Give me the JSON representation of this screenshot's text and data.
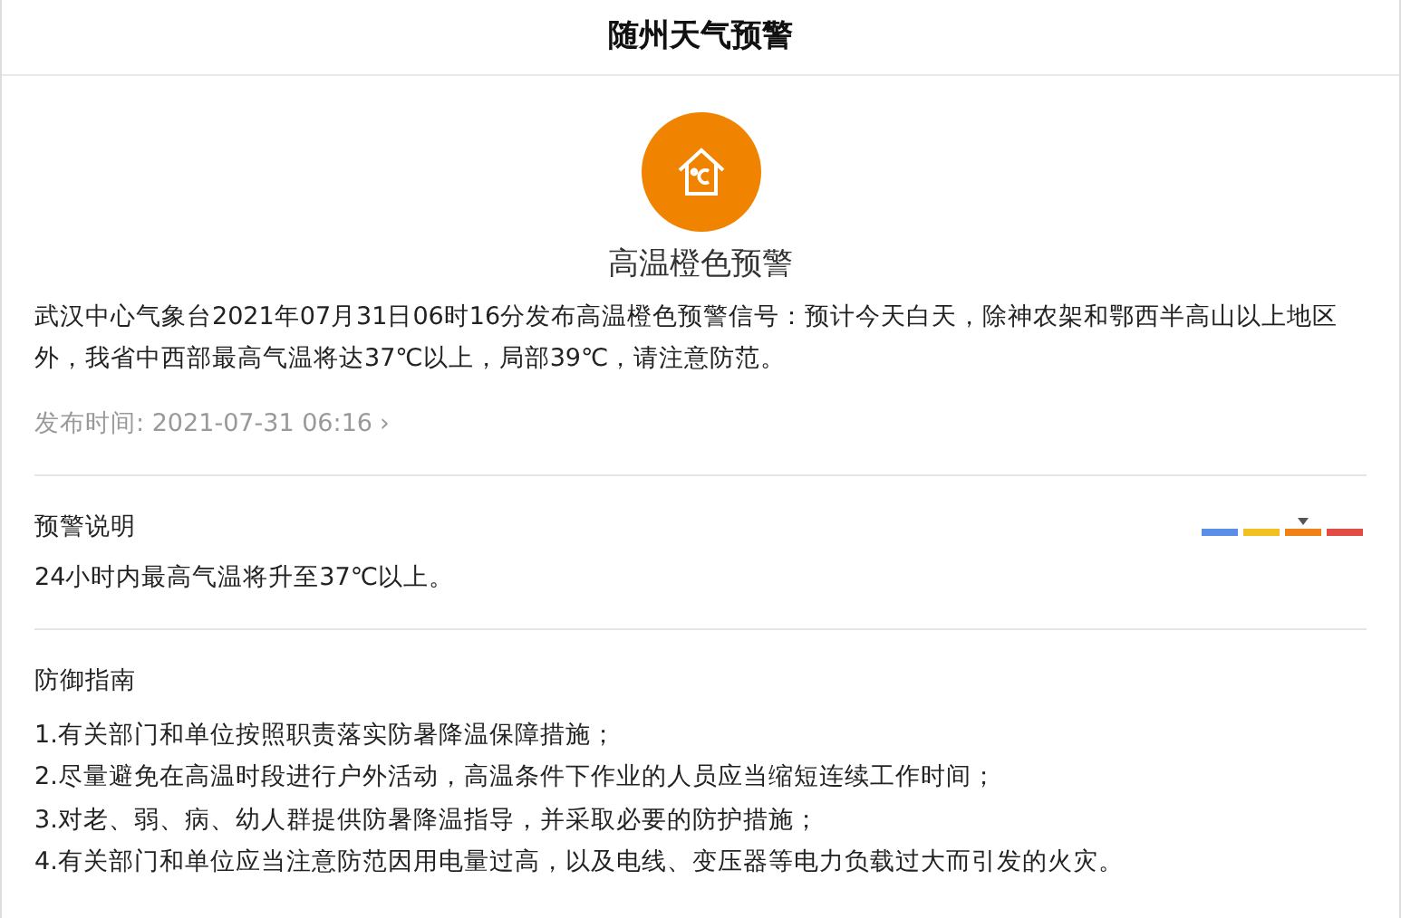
{
  "header": {
    "title": "随州天气预警"
  },
  "alert": {
    "level_name": "高温橙色预警",
    "color": "#f08300",
    "text": "武汉中心气象台2021年07月31日06时16分发布高温橙色预警信号：预计今天白天，除神农架和鄂西半高山以上地区外，我省中西部最高气温将达37℃以上，局部39℃，请注意防范。",
    "published": "发布时间: 2021-07-31 06:16",
    "more": "›"
  },
  "description": {
    "title": "预警说明",
    "text": "24小时内最高气温将升至37℃以上。",
    "scale": [
      {
        "color": "#5b8ee6",
        "selected": false
      },
      {
        "color": "#f2c01f",
        "selected": false
      },
      {
        "color": "#ee8216",
        "selected": true
      },
      {
        "color": "#e34b45",
        "selected": false
      }
    ]
  },
  "guide": {
    "title": "防御指南",
    "items": [
      "1.有关部门和单位按照职责落实防暑降温保障措施；",
      "2.尽量避免在高温时段进行户外活动，高温条件下作业的人员应当缩短连续工作时间；",
      "3.对老、弱、病、幼人群提供防暑降温指导，并采取必要的防护措施；",
      "4.有关部门和单位应当注意防范因用电量过高，以及电线、变压器等电力负载过大而引发的火灾。"
    ]
  }
}
